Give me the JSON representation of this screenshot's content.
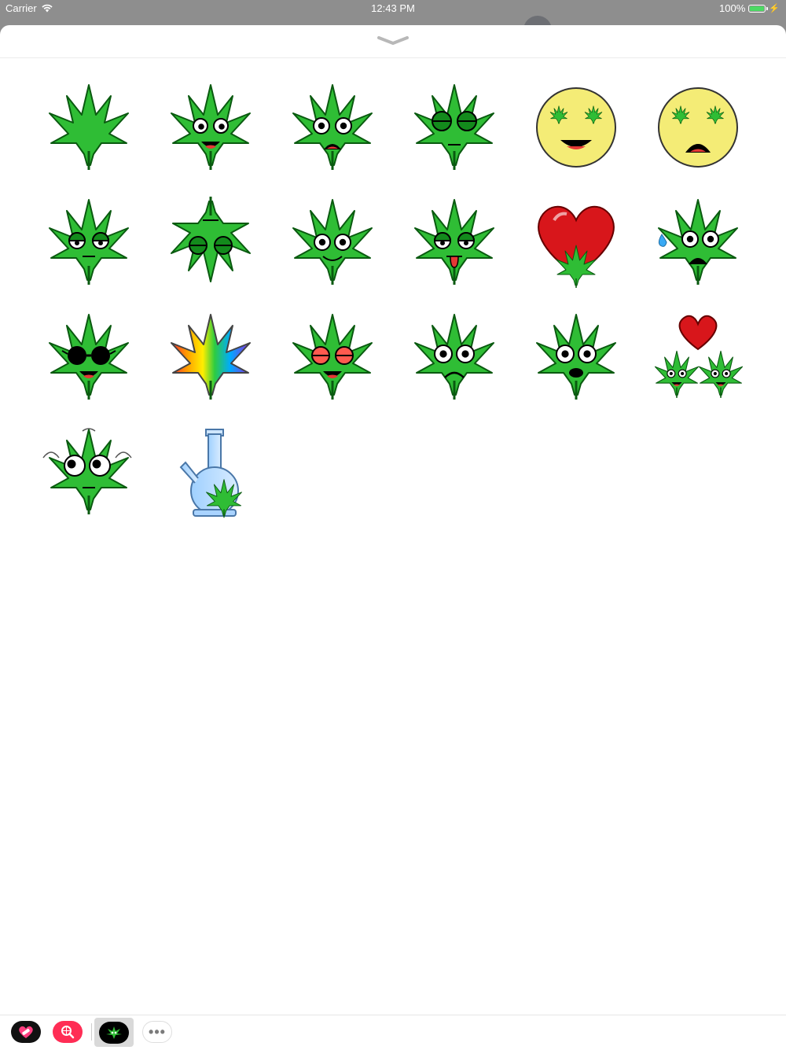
{
  "status_bar": {
    "carrier": "Carrier",
    "time": "12:43 PM",
    "battery": "100%",
    "battery_level": 1.0
  },
  "colors": {
    "leaf": "#2fbd35",
    "leaf_dark": "#138a1c",
    "heart": "#d8161b",
    "face_yellow": "#f4ec76",
    "status_bar_bg": "#8e8e8e"
  },
  "stickers": [
    {
      "name": "plain-leaf",
      "icon": "cannabis-leaf-icon"
    },
    {
      "name": "happy-leaf-tongue",
      "icon": "happy-leaf-icon"
    },
    {
      "name": "shocked-leaf",
      "icon": "shocked-leaf-icon"
    },
    {
      "name": "sleepy-leaf",
      "icon": "sleepy-leaf-icon"
    },
    {
      "name": "leaf-eyes-smile-face",
      "icon": "smiley-face-icon"
    },
    {
      "name": "leaf-eyes-frown-face",
      "icon": "frown-face-icon"
    },
    {
      "name": "tired-leaf",
      "icon": "tired-leaf-icon"
    },
    {
      "name": "upside-down-leaf",
      "icon": "upside-down-leaf-icon"
    },
    {
      "name": "smiling-leaf",
      "icon": "smiling-leaf-icon"
    },
    {
      "name": "tongue-out-leaf",
      "icon": "tongue-leaf-icon"
    },
    {
      "name": "heart-leaf",
      "icon": "heart-icon"
    },
    {
      "name": "nervous-sweat-leaf",
      "icon": "sweat-leaf-icon"
    },
    {
      "name": "sunglasses-leaf",
      "icon": "sunglasses-leaf-icon"
    },
    {
      "name": "rainbow-leaf",
      "icon": "rainbow-leaf-icon"
    },
    {
      "name": "red-eyes-leaf",
      "icon": "red-eyes-leaf-icon"
    },
    {
      "name": "sad-leaf",
      "icon": "sad-leaf-icon"
    },
    {
      "name": "surprised-leaf",
      "icon": "surprised-leaf-icon"
    },
    {
      "name": "leaf-couple-heart",
      "icon": "couple-heart-icon"
    },
    {
      "name": "dizzy-leaf",
      "icon": "dizzy-leaf-icon"
    },
    {
      "name": "bong",
      "icon": "bong-icon"
    }
  ],
  "app_drawer": [
    {
      "name": "app-icon-heart",
      "icon": "heart-bandage-icon",
      "bg": "#111111",
      "fg": "#ff3d7f"
    },
    {
      "name": "app-icon-search",
      "icon": "globe-search-icon",
      "bg": "#ff2d55",
      "fg": "#ffffff"
    },
    {
      "name": "app-icon-weed-stickers",
      "icon": "leaf-sticker-icon",
      "bg": "#000000",
      "fg": "#2fbd35",
      "selected": true
    },
    {
      "name": "app-icon-more",
      "icon": "more-dots-icon",
      "glyph": "•••"
    }
  ]
}
